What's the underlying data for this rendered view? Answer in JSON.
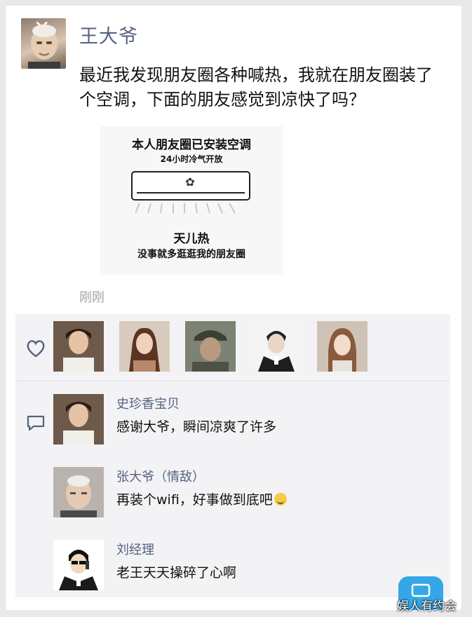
{
  "post": {
    "author": "王大爷",
    "text": "最近我发现朋友圈各种喊热，我就在朋友圈装了个空调，下面的朋友感觉到凉快了吗？",
    "time": "刚刚",
    "image": {
      "title": "本人朋友圈已安装空调",
      "subtitle": "24小时冷气开放",
      "line1": "天儿热",
      "line2": "没事就多逛逛我的朋友圈"
    }
  },
  "likes": {
    "icon": "heart-icon",
    "count_avatars": 5
  },
  "comments": [
    {
      "name": "史珍香宝贝",
      "text": "感谢大爷，瞬间凉爽了许多"
    },
    {
      "name": "张大爷（情敌）",
      "text": "再装个wifi，好事做到底吧"
    },
    {
      "name": "刘经理",
      "text": "老王天天操碎了心啊"
    }
  ],
  "watermark": "娱人有约会",
  "colors": {
    "name_color": "#56627e",
    "time_color": "#a2a2a2",
    "panel_bg": "#f3f3f5",
    "fab": "#35a7e6"
  }
}
